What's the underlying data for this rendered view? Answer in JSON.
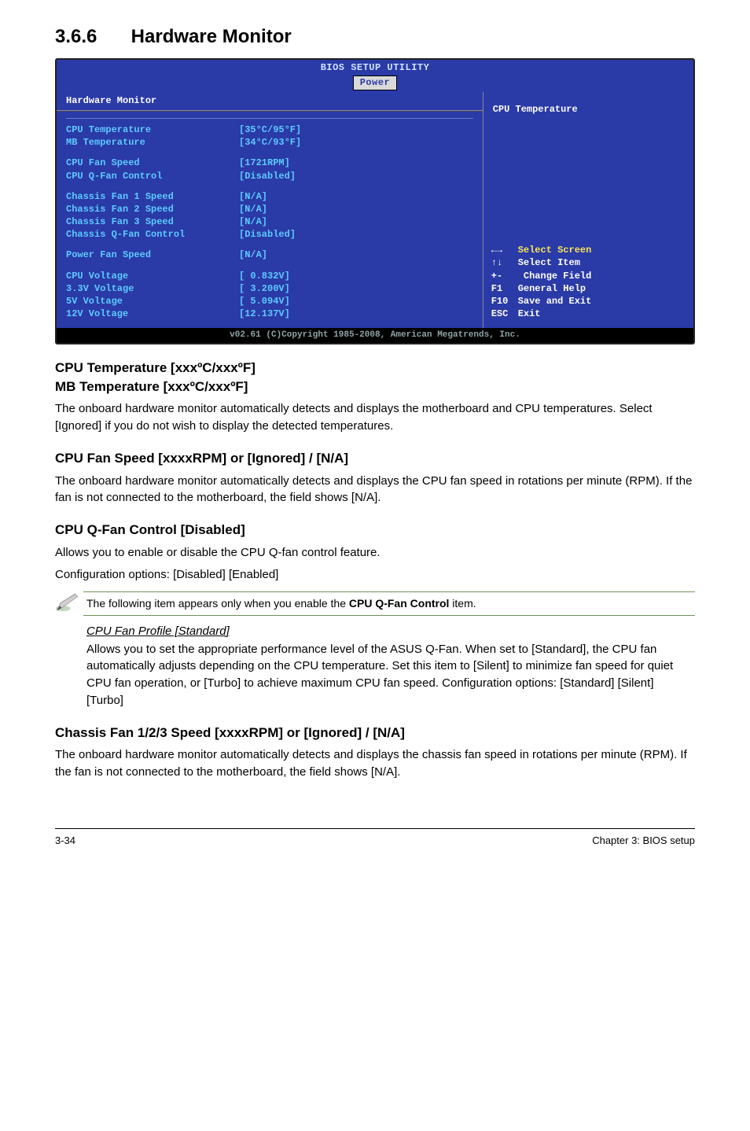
{
  "section": {
    "number": "3.6.6",
    "title": "Hardware Monitor"
  },
  "bios": {
    "header": "BIOS SETUP UTILITY",
    "tab": "Power",
    "panel_title": "Hardware Monitor",
    "rows": [
      {
        "k": "CPU Temperature",
        "v": "[35°C/95°F]",
        "cls": "cyan"
      },
      {
        "k": "MB Temperature",
        "v": "[34°C/93°F]",
        "cls": "cyan"
      },
      {
        "spacer": true
      },
      {
        "k": "CPU Fan Speed",
        "v": "[1721RPM]",
        "cls": "cyan"
      },
      {
        "k": "CPU Q-Fan Control",
        "v": "[Disabled]",
        "cls": "cyan"
      },
      {
        "spacer": true
      },
      {
        "k": "Chassis Fan 1 Speed",
        "v": "[N/A]",
        "cls": "cyan"
      },
      {
        "k": "Chassis Fan 2 Speed",
        "v": "[N/A]",
        "cls": "cyan"
      },
      {
        "k": "Chassis Fan 3 Speed",
        "v": "[N/A]",
        "cls": "cyan"
      },
      {
        "k": "Chassis Q-Fan Control",
        "v": "[Disabled]",
        "cls": "cyan"
      },
      {
        "spacer": true
      },
      {
        "k": "Power Fan Speed",
        "v": "[N/A]",
        "cls": "cyan"
      },
      {
        "spacer": true
      },
      {
        "k": "CPU   Voltage",
        "v": "[ 0.832V]",
        "cls": "cyan"
      },
      {
        "k": "3.3V  Voltage",
        "v": "[ 3.200V]",
        "cls": "cyan"
      },
      {
        "k": "5V    Voltage",
        "v": "[ 5.094V]",
        "cls": "cyan"
      },
      {
        "k": "12V   Voltage",
        "v": "[12.137V]",
        "cls": "cyan"
      }
    ],
    "help_text": "CPU Temperature",
    "legend": [
      {
        "sym": "←→",
        "txt": "Select Screen",
        "yellow": true
      },
      {
        "sym": "↑↓",
        "txt": "Select Item"
      },
      {
        "sym": "+-",
        "txt": "  Change Field"
      },
      {
        "sym": "F1",
        "txt": "General Help"
      },
      {
        "sym": "F10",
        "txt": "Save and Exit"
      },
      {
        "sym": "ESC",
        "txt": "Exit"
      }
    ],
    "footer": "v02.61 (C)Copyright 1985-2008, American Megatrends, Inc."
  },
  "sections": {
    "temp_heading1": "CPU Temperature [xxxºC/xxxºF]",
    "temp_heading2": "MB Temperature [xxxºC/xxxºF]",
    "temp_body": "The onboard hardware monitor automatically detects and displays the motherboard and CPU temperatures. Select [Ignored] if you do not wish to display the detected temperatures.",
    "cpufan_heading": "CPU Fan Speed [xxxxRPM] or [Ignored] / [N/A]",
    "cpufan_body": "The onboard hardware monitor automatically detects and displays the CPU fan speed in rotations per minute (RPM). If the fan is not connected to the motherboard, the field shows [N/A].",
    "qfan_heading": "CPU Q-Fan Control [Disabled]",
    "qfan_body1": "Allows you to enable or disable the CPU Q-fan control feature.",
    "qfan_body2": "Configuration options: [Disabled] [Enabled]",
    "note_prefix": "The following item appears only when you enable the ",
    "note_bold": "CPU Q-Fan Control",
    "note_suffix": " item.",
    "profile_title": "CPU Fan Profile [Standard]",
    "profile_body": "Allows you to set the appropriate performance level of the ASUS Q-Fan. When set to [Standard], the CPU fan automatically adjusts depending on the CPU temperature. Set this item to [Silent] to minimize fan speed for quiet CPU fan operation, or [Turbo] to achieve maximum CPU fan speed. Configuration options: [Standard] [Silent] [Turbo]",
    "chassis_heading": "Chassis Fan 1/2/3 Speed [xxxxRPM] or [Ignored] / [N/A]",
    "chassis_body": "The onboard hardware monitor automatically detects and displays the chassis fan speed in rotations per minute (RPM). If the fan is not connected to the motherboard, the field shows [N/A]."
  },
  "footer": {
    "left": "3-34",
    "right": "Chapter 3: BIOS setup"
  }
}
